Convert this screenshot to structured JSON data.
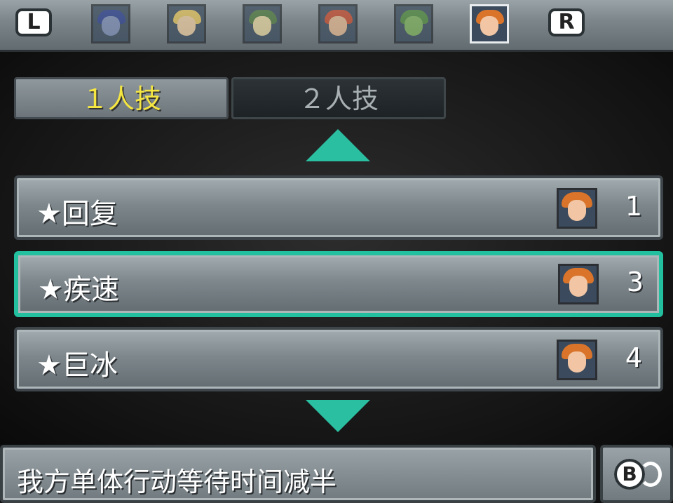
{
  "topbar": {
    "left_shoulder": "L",
    "right_shoulder": "R",
    "characters": [
      {
        "id": "magus",
        "hair": "#2b3f8f",
        "face": "#7f8fb8",
        "active": false
      },
      {
        "id": "ayla",
        "hair": "#e6c45a",
        "face": "#f0cfa0",
        "active": false
      },
      {
        "id": "robo",
        "hair": "#4f7a3c",
        "face": "#e9d8a0",
        "active": false
      },
      {
        "id": "crono",
        "hair": "#c94a2a",
        "face": "#e8b98f",
        "active": false
      },
      {
        "id": "frog",
        "hair": "#4f8a3a",
        "face": "#7fb35a",
        "active": false
      },
      {
        "id": "marle",
        "hair": "#d9742a",
        "face": "#f2c6a4",
        "active": true
      }
    ]
  },
  "tabs": {
    "single": "１人技",
    "double": "２人技"
  },
  "skills": [
    {
      "name": "★回复",
      "cost": "1",
      "selected": false
    },
    {
      "name": "★疾速",
      "cost": "3",
      "selected": true
    },
    {
      "name": "★巨冰",
      "cost": "4",
      "selected": false
    }
  ],
  "description": "我方单体行动等待时间减半",
  "back_button": "B",
  "colors": {
    "accent": "#2bbfa1",
    "active_tab_text": "#f5e642"
  }
}
